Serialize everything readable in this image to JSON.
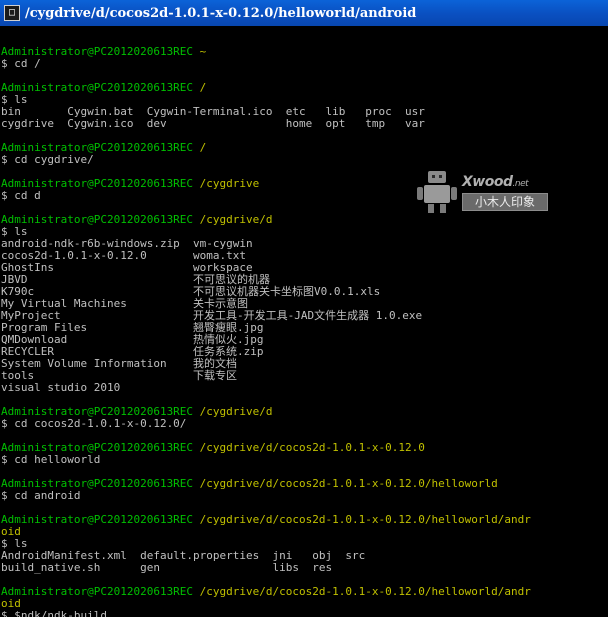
{
  "window": {
    "title": "/cygdrive/d/cocos2d-1.0.1-x-0.12.0/helloworld/android"
  },
  "watermark": {
    "brand": "Xwood",
    "brand_suffix": ".net",
    "tagline": "小木人印象"
  },
  "terminal": {
    "lines": [
      [],
      [
        {
          "t": "Administrator@PC2012020613REC",
          "c": "g"
        },
        {
          "t": " ~",
          "c": "y"
        }
      ],
      [
        {
          "t": "$ cd /",
          "c": "w"
        }
      ],
      [],
      [
        {
          "t": "Administrator@PC2012020613REC",
          "c": "g"
        },
        {
          "t": " /",
          "c": "y"
        }
      ],
      [
        {
          "t": "$ ls",
          "c": "w"
        }
      ],
      [
        {
          "t": "bin       Cygwin.bat  Cygwin-Terminal.ico  etc   lib   proc  usr",
          "c": "w"
        }
      ],
      [
        {
          "t": "cygdrive  Cygwin.ico  dev                  home  opt   tmp   var",
          "c": "w"
        }
      ],
      [],
      [
        {
          "t": "Administrator@PC2012020613REC",
          "c": "g"
        },
        {
          "t": " /",
          "c": "y"
        }
      ],
      [
        {
          "t": "$ cd cygdrive/",
          "c": "w"
        }
      ],
      [],
      [
        {
          "t": "Administrator@PC2012020613REC",
          "c": "g"
        },
        {
          "t": " /cygdrive",
          "c": "y"
        }
      ],
      [
        {
          "t": "$ cd d",
          "c": "w"
        }
      ],
      [],
      [
        {
          "t": "Administrator@PC2012020613REC",
          "c": "g"
        },
        {
          "t": " /cygdrive/d",
          "c": "y"
        }
      ],
      [
        {
          "t": "$ ls",
          "c": "w"
        }
      ],
      [
        {
          "t": "android-ndk-r6b-windows.zip  vm-cygwin",
          "c": "w"
        }
      ],
      [
        {
          "t": "cocos2d-1.0.1-x-0.12.0       woma.txt",
          "c": "w"
        }
      ],
      [
        {
          "t": "GhostIns                     workspace",
          "c": "w"
        }
      ],
      [
        {
          "t": "JBVD                         不可思议的机器",
          "c": "w"
        }
      ],
      [
        {
          "t": "K790c                        不可思议机器关卡坐标图V0.0.1.xls",
          "c": "w"
        }
      ],
      [
        {
          "t": "My Virtual Machines          关卡示意图",
          "c": "w"
        }
      ],
      [
        {
          "t": "MyProject                    开发工具-开发工具-JAD文件生成器 1.0.exe",
          "c": "w"
        }
      ],
      [
        {
          "t": "Program Files                翘臀瘦眼.jpg",
          "c": "w"
        }
      ],
      [
        {
          "t": "QMDownload                   热情似火.jpg",
          "c": "w"
        }
      ],
      [
        {
          "t": "RECYCLER                     任务系统.zip",
          "c": "w"
        }
      ],
      [
        {
          "t": "System Volume Information    我的文档",
          "c": "w"
        }
      ],
      [
        {
          "t": "tools                        下载专区",
          "c": "w"
        }
      ],
      [
        {
          "t": "visual studio 2010",
          "c": "w"
        }
      ],
      [],
      [
        {
          "t": "Administrator@PC2012020613REC",
          "c": "g"
        },
        {
          "t": " /cygdrive/d",
          "c": "y"
        }
      ],
      [
        {
          "t": "$ cd cocos2d-1.0.1-x-0.12.0/",
          "c": "w"
        }
      ],
      [],
      [
        {
          "t": "Administrator@PC2012020613REC",
          "c": "g"
        },
        {
          "t": " /cygdrive/d/cocos2d-1.0.1-x-0.12.0",
          "c": "y"
        }
      ],
      [
        {
          "t": "$ cd helloworld",
          "c": "w"
        }
      ],
      [],
      [
        {
          "t": "Administrator@PC2012020613REC",
          "c": "g"
        },
        {
          "t": " /cygdrive/d/cocos2d-1.0.1-x-0.12.0/helloworld",
          "c": "y"
        }
      ],
      [
        {
          "t": "$ cd android",
          "c": "w"
        }
      ],
      [],
      [
        {
          "t": "Administrator@PC2012020613REC",
          "c": "g"
        },
        {
          "t": " /cygdrive/d/cocos2d-1.0.1-x-0.12.0/helloworld/andr",
          "c": "y"
        }
      ],
      [
        {
          "t": "oid",
          "c": "y"
        }
      ],
      [
        {
          "t": "$ ls",
          "c": "w"
        }
      ],
      [
        {
          "t": "AndroidManifest.xml  default.properties  jni   obj  src",
          "c": "w"
        }
      ],
      [
        {
          "t": "build_native.sh      gen                 libs  res",
          "c": "w"
        }
      ],
      [],
      [
        {
          "t": "Administrator@PC2012020613REC",
          "c": "g"
        },
        {
          "t": " /cygdrive/d/cocos2d-1.0.1-x-0.12.0/helloworld/andr",
          "c": "y"
        }
      ],
      [
        {
          "t": "oid",
          "c": "y"
        }
      ],
      [
        {
          "t": "$ $ndk/ndk-build",
          "c": "w"
        }
      ]
    ]
  }
}
